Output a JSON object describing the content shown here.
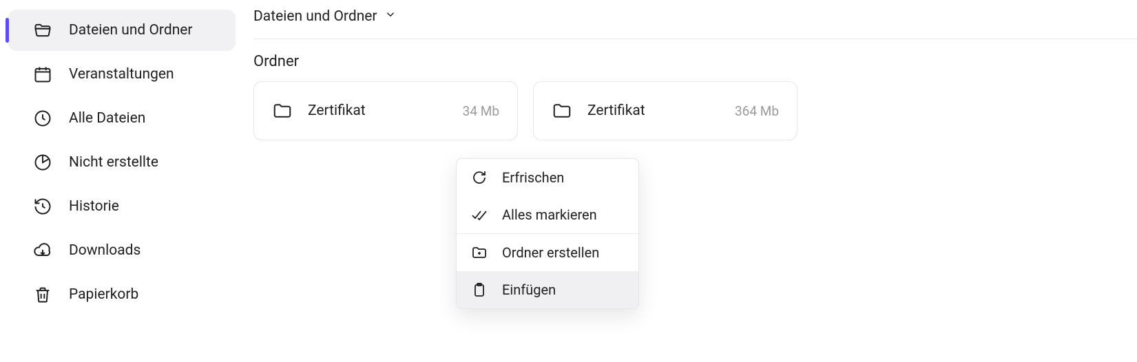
{
  "sidebar": {
    "items": [
      {
        "label": "Dateien und Ordner",
        "icon": "folder-open-icon",
        "active": true
      },
      {
        "label": "Veranstaltungen",
        "icon": "calendar-icon",
        "active": false
      },
      {
        "label": "Alle Dateien",
        "icon": "clock-icon",
        "active": false
      },
      {
        "label": "Nicht erstellte",
        "icon": "pie-slice-icon",
        "active": false
      },
      {
        "label": "Historie",
        "icon": "history-icon",
        "active": false
      },
      {
        "label": "Downloads",
        "icon": "cloud-download-icon",
        "active": false
      },
      {
        "label": "Papierkorb",
        "icon": "trash-icon",
        "active": false
      }
    ]
  },
  "main": {
    "breadcrumb": "Dateien und Ordner",
    "section_title": "Ordner",
    "folders": [
      {
        "name": "Zertifikat",
        "size": "34 Mb"
      },
      {
        "name": "Zertifikat",
        "size": "364 Mb"
      }
    ]
  },
  "context_menu": {
    "items": [
      {
        "label": "Erfrischen",
        "icon": "refresh-icon"
      },
      {
        "label": "Alles markieren",
        "icon": "check-all-icon"
      },
      {
        "label": "Ordner erstellen",
        "icon": "new-folder-icon"
      },
      {
        "label": "Einfügen",
        "icon": "clipboard-icon"
      }
    ]
  }
}
